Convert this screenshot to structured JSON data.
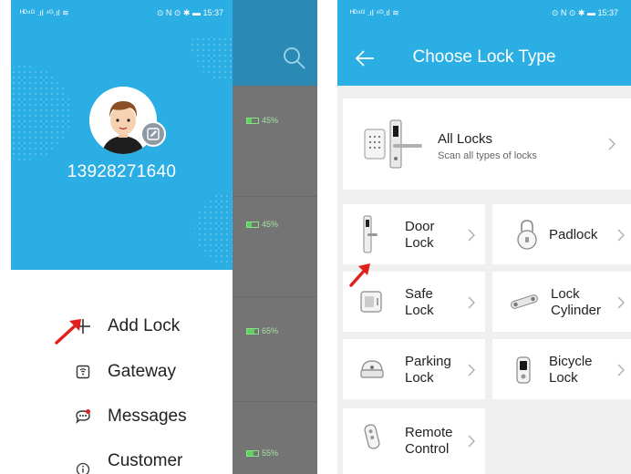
{
  "left": {
    "status": {
      "left_text": "ᴴᴰ⁴ᴳ .ıl ⁴ᴳ.ıl ≋",
      "right_text": "⊙ N ⊙ ✱ ▬ 15:37"
    },
    "phone_number": "13928271640",
    "menu": [
      {
        "label": "Add Lock",
        "icon": "plus-icon"
      },
      {
        "label": "Gateway",
        "icon": "gateway-icon"
      },
      {
        "label": "Messages",
        "icon": "chat-bubble-icon"
      },
      {
        "label": "Customer",
        "icon": "info-icon"
      }
    ],
    "background_list": [
      {
        "battery": "45%",
        "level": 0.45
      },
      {
        "battery": "45%",
        "level": 0.45
      },
      {
        "battery": "65%",
        "level": 0.65
      },
      {
        "battery": "55%",
        "level": 0.55
      }
    ]
  },
  "right": {
    "status": {
      "left_text": "ᴴᴰ⁴ᴳ .ıl ⁴ᴳ.ıl ≋",
      "right_text": "⊙ N ⊙ ✱ ▬ 15:37"
    },
    "title": "Choose Lock Type",
    "all_locks": {
      "title": "All Locks",
      "subtitle": "Scan all types of locks"
    },
    "types": [
      {
        "line1": "Door",
        "line2": "Lock"
      },
      {
        "line1": "Padlock",
        "line2": ""
      },
      {
        "line1": "Safe",
        "line2": "Lock"
      },
      {
        "line1": "Lock",
        "line2": "Cylinder"
      },
      {
        "line1": "Parking",
        "line2": "Lock"
      },
      {
        "line1": "Bicycle",
        "line2": "Lock"
      },
      {
        "line1": "Remote",
        "line2": "Control"
      }
    ]
  },
  "colors": {
    "brand": "#2aaee4",
    "annotation_arrow": "#e0201c",
    "battery": "#5cd45c"
  }
}
